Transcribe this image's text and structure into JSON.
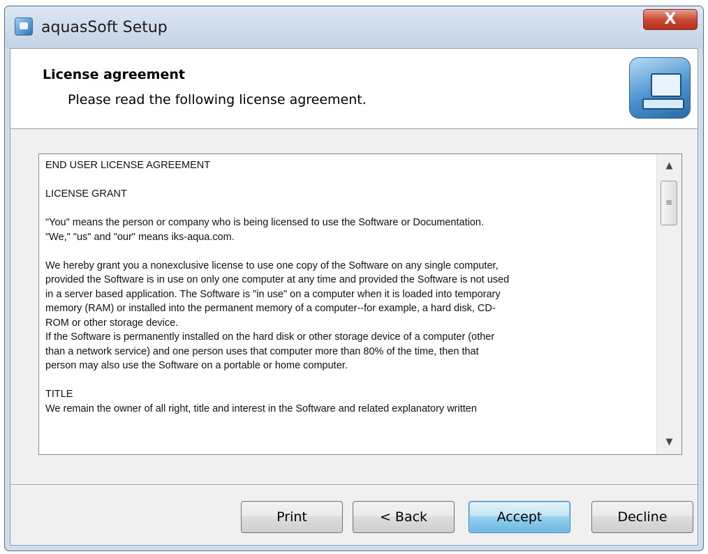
{
  "window": {
    "title": "aquasSoft Setup",
    "close_glyph": "X"
  },
  "header": {
    "title": "License agreement",
    "subtitle": "Please read the following license agreement."
  },
  "license": {
    "lines": [
      "END USER LICENSE AGREEMENT",
      "",
      "LICENSE GRANT",
      "",
      "\"You\" means the person or company who is being licensed to use the Software or Documentation.",
      "\"We,\" \"us\" and \"our\" means iks-aqua.com.",
      "",
      "We hereby grant you a nonexclusive license to use one copy of the Software on any single computer,",
      "provided the Software is in use on only one computer at any time and provided the Software is not used",
      "in a server based application. The Software is \"in use\" on a computer when it is loaded into temporary",
      "memory (RAM) or installed into the permanent memory of a computer--for example, a hard disk, CD-",
      "ROM or other storage device.",
      "If the Software is permanently installed on the hard disk or other storage device of a computer (other",
      "than a network service) and one person uses that computer more than 80% of the time, then that",
      "person may also use the Software on a portable or home computer.",
      "",
      "TITLE",
      "We remain the owner of all right, title and interest in the Software and related explanatory written"
    ],
    "scroll_up_glyph": "▲",
    "scroll_down_glyph": "▼",
    "scroll_grip_glyph": "≡"
  },
  "buttons": {
    "print": "Print",
    "back": "< Back",
    "accept": "Accept",
    "decline": "Decline"
  },
  "icons": {
    "app": "setup-app-icon",
    "header": "computer-install-icon",
    "close": "close-icon"
  }
}
